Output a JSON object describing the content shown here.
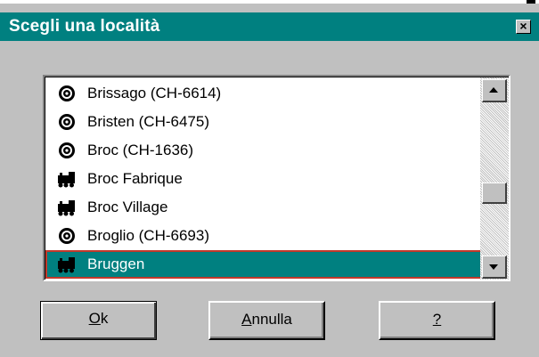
{
  "window": {
    "title": "Scegli una località",
    "close_label": "×"
  },
  "list": {
    "items": [
      {
        "label": "Brissago (CH-6614)",
        "icon": "post-office-icon"
      },
      {
        "label": "Bristen (CH-6475)",
        "icon": "post-office-icon"
      },
      {
        "label": "Broc (CH-1636)",
        "icon": "post-office-icon"
      },
      {
        "label": "Broc Fabrique",
        "icon": "train-station-icon"
      },
      {
        "label": "Broc Village",
        "icon": "train-station-icon"
      },
      {
        "label": "Broglio (CH-6693)",
        "icon": "post-office-icon"
      },
      {
        "label": "Bruggen",
        "icon": "train-station-icon"
      }
    ],
    "selected_index": 6
  },
  "buttons": {
    "ok_underlined": "O",
    "ok_rest": "k",
    "annulla_underlined": "A",
    "annulla_rest": "nnulla",
    "help_label": "?"
  },
  "colors": {
    "title_bar": "#008080",
    "selection": "#008080",
    "dialog_bg": "#c0c0c0"
  }
}
